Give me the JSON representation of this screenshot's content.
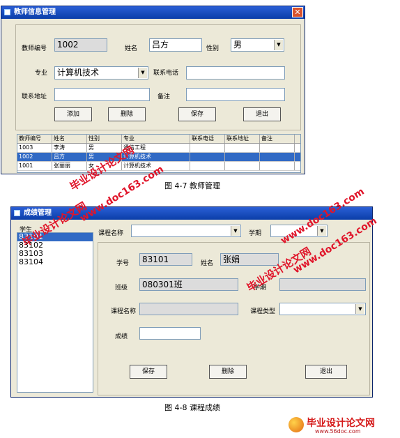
{
  "teacher_window": {
    "title": "教师信息管理",
    "close_glyph": "✕",
    "labels": {
      "teacher_id": "教师编号",
      "name": "姓名",
      "gender": "性别",
      "major": "专业",
      "phone": "联系电话",
      "address": "联系地址",
      "remark": "备注"
    },
    "values": {
      "teacher_id": "1002",
      "name": "吕方",
      "gender": "男",
      "major": "计算机技术",
      "phone": "",
      "address": "",
      "remark": ""
    },
    "buttons": {
      "add": "添加",
      "delete": "删除",
      "save": "保存",
      "exit": "退出"
    },
    "grid": {
      "headers": [
        "教师编号",
        "姓名",
        "性别",
        "专业",
        "联系电话",
        "联系地址",
        "备注"
      ],
      "rows": [
        [
          "1003",
          "李涛",
          "男",
          "通信工程",
          "",
          "",
          ""
        ],
        [
          "1002",
          "吕方",
          "男",
          "计算机技术",
          "",
          "",
          ""
        ],
        [
          "1001",
          "张丽丽",
          "女",
          "计算机技术",
          "",
          "",
          ""
        ]
      ],
      "selected_row": 1
    }
  },
  "caption_1": "图 4-7  教师管理",
  "grade_window": {
    "title": "成绩管理",
    "student_list_label": "学生",
    "students": [
      "83101",
      "83102",
      "83103",
      "83104"
    ],
    "selected_student": 0,
    "labels": {
      "course_name_top": "课程名称",
      "semester": "学期",
      "student_id": "学号",
      "name": "姓名",
      "class": "班级",
      "semester2": "学期",
      "course_name": "课程名称",
      "course_type": "课程类型",
      "score": "成绩"
    },
    "values": {
      "course_name_top": "",
      "semester": "",
      "student_id": "83101",
      "name": "张娟",
      "class": "080301班",
      "semester2": "",
      "course_name": "",
      "course_type": "",
      "score": ""
    },
    "buttons": {
      "save": "保存",
      "delete": "删除",
      "exit": "退出"
    }
  },
  "caption_2": "图 4-8  课程成绩",
  "watermarks": {
    "site_name": "毕业设计论文网",
    "site_url": "www.doc163.com"
  },
  "footer_logo": {
    "name": "毕业设计论文网",
    "url": "www.56doc.com"
  },
  "colors": {
    "titlebar": "#0b3ea8",
    "selection": "#316ac5",
    "watermark": "#e0152a",
    "window_bg": "#ece9d8"
  }
}
